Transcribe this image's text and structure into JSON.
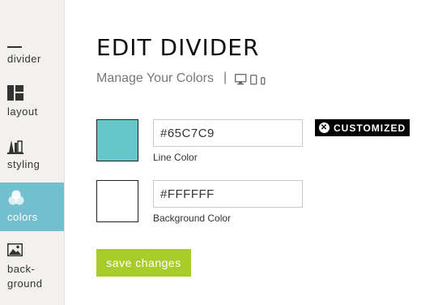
{
  "sidebar": {
    "items": [
      {
        "label": "divider"
      },
      {
        "label": "layout"
      },
      {
        "label": "styling"
      },
      {
        "label": "colors"
      },
      {
        "label": "back-",
        "label2": "ground"
      }
    ],
    "active": "colors"
  },
  "header": {
    "title": "EDIT DIVIDER",
    "subtitle": "Manage Your Colors",
    "separator": "|"
  },
  "colors": {
    "line": {
      "value": "#65C7C9",
      "label": "Line Color",
      "swatch": "#65c7c9"
    },
    "background": {
      "value": "#FFFFFF",
      "label": "Background Color",
      "swatch": "#ffffff"
    }
  },
  "badge": {
    "label": "CUSTOMIZED",
    "icon": "close-circle-icon"
  },
  "actions": {
    "save_label": "save changes"
  },
  "theme": {
    "accent": "#72c0cf",
    "save": "#a8cc2a"
  }
}
